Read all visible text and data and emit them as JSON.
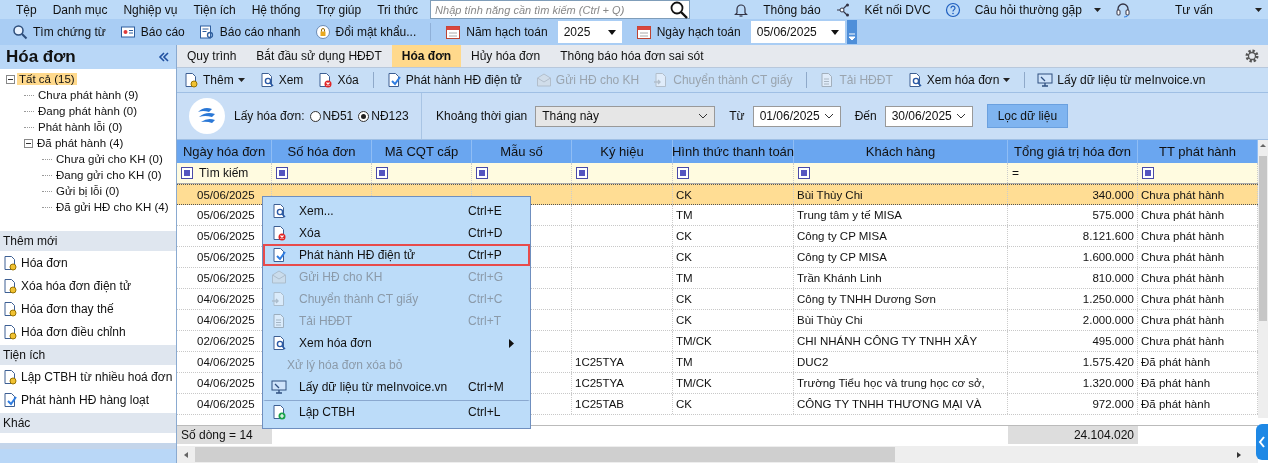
{
  "menu_bar": {
    "items": [
      "Tệp",
      "Danh mục",
      "Nghiệp vụ",
      "Tiện ích",
      "Hệ thống",
      "Trợ giúp",
      "Tri thức"
    ],
    "search": {
      "placeholder": "Nhập tính năng cần tìm kiếm (Ctrl + Q)"
    },
    "links": [
      {
        "label": "Thông báo",
        "dropdown": false
      },
      {
        "label": "Kết nối DVC",
        "dropdown": false
      },
      {
        "label": "Câu hỏi thường gặp",
        "dropdown": true
      },
      {
        "label": "Tư vấn",
        "dropdown": true
      }
    ]
  },
  "toolbar": {
    "buttons": [
      "Tìm chứng từ",
      "Báo cáo",
      "Báo cáo nhanh",
      "Đổi mật khẩu..."
    ],
    "year": {
      "label": "Năm hạch toán",
      "value": "2025"
    },
    "date": {
      "label": "Ngày hạch toán",
      "value": "05/06/2025"
    }
  },
  "sidebar": {
    "title": "Hóa đơn",
    "tree": [
      {
        "label": "Tất cả (15)",
        "selected": true,
        "expanded": true,
        "children": [
          {
            "label": "Chưa phát hành (9)",
            "selected": false
          },
          {
            "label": "Đang phát hành (0)",
            "selected": false
          },
          {
            "label": "Phát hành lỗi (0)",
            "selected": false
          },
          {
            "label": "Đã phát hành (4)",
            "selected": false,
            "expanded": true,
            "children": [
              {
                "label": "Chưa gửi cho KH (0)",
                "selected": false
              },
              {
                "label": "Đang gửi cho KH (0)",
                "selected": false
              },
              {
                "label": "Gửi bị lỗi (0)",
                "selected": false
              },
              {
                "label": "Đã gửi HĐ cho KH (4)",
                "selected": false
              }
            ]
          }
        ]
      }
    ],
    "sections": [
      {
        "title": "Thêm mới",
        "items": [
          "Hóa đơn",
          "Xóa hóa đơn điện tử",
          "Hóa đơn thay thế",
          "Hóa đơn điều chỉnh"
        ]
      },
      {
        "title": "Tiện ích",
        "items": [
          "Lập CTBH từ nhiều hoá đơn",
          "Phát hành HĐ hàng loạt"
        ]
      },
      {
        "title": "Khác"
      }
    ]
  },
  "tabs": [
    {
      "label": "Quy trình",
      "selected": false
    },
    {
      "label": "Bắt đầu sử dụng HĐĐT",
      "selected": false
    },
    {
      "label": "Hóa đơn",
      "selected": true
    },
    {
      "label": "Hủy hóa đơn",
      "selected": false
    },
    {
      "label": "Thông báo hóa đơn sai sót",
      "selected": false
    }
  ],
  "actions": [
    {
      "label": "Thêm",
      "disabled": false,
      "dropdown": true,
      "separator_before": false
    },
    {
      "label": "Xem",
      "disabled": false,
      "dropdown": false,
      "separator_before": false
    },
    {
      "label": "Xóa",
      "disabled": false,
      "dropdown": false,
      "separator_before": false
    },
    {
      "label": "Phát hành HĐ điện tử",
      "disabled": false,
      "dropdown": false,
      "separator_before": true
    },
    {
      "label": "Gửi HĐ cho KH",
      "disabled": true,
      "dropdown": false,
      "separator_before": false
    },
    {
      "label": "Chuyển thành CT giấy",
      "disabled": true,
      "dropdown": false,
      "separator_before": false
    },
    {
      "label": "Tải HĐĐT",
      "disabled": true,
      "dropdown": false,
      "separator_before": true
    },
    {
      "label": "Xem hóa đơn",
      "disabled": false,
      "dropdown": true,
      "separator_before": false
    },
    {
      "label": "Lấy dữ liệu từ meInvoice.vn",
      "disabled": false,
      "dropdown": false,
      "separator_before": true
    }
  ],
  "filter": {
    "source_label": "Lấy hóa đơn:",
    "sources": [
      {
        "label": "NĐ51",
        "selected": false
      },
      {
        "label": "NĐ123",
        "selected": true
      }
    ],
    "period_label": "Khoảng thời gian",
    "period": "Tháng này",
    "from_label": "Từ",
    "from": "01/06/2025",
    "to_label": "Đến",
    "to": "30/06/2025",
    "button": "Lọc dữ liệu"
  },
  "table": {
    "columns": [
      {
        "label": "Ngày hóa đơn",
        "kind": "text"
      },
      {
        "label": "Số hóa đơn",
        "kind": "text"
      },
      {
        "label": "Mã CQT cấp",
        "kind": "text"
      },
      {
        "label": "Mẫu số",
        "kind": "text"
      },
      {
        "label": "Ký hiệu",
        "kind": "text"
      },
      {
        "label": "Hình thức thanh toán",
        "kind": "text"
      },
      {
        "label": "Khách hàng",
        "kind": "text"
      },
      {
        "label": "Tổng giá trị hóa đơn",
        "kind": "amount",
        "filter_op": "="
      },
      {
        "label": "TT phát hành",
        "kind": "text"
      }
    ],
    "search_placeholder": "Tìm kiếm",
    "rows": [
      {
        "date": "05/06/2025",
        "payment": "CK",
        "customer": "Bùi Thùy Chi",
        "total": "340.000",
        "status": "Chưa phát hành",
        "selected": true
      },
      {
        "date": "05/06/2025",
        "payment": "TM",
        "customer": "Trung tâm y tế MISA",
        "total": "575.000",
        "status": "Chưa phát hành",
        "selected": false
      },
      {
        "date": "05/06/2025",
        "payment": "CK",
        "customer": "Công ty CP MISA",
        "total": "8.121.600",
        "status": "Chưa phát hành",
        "selected": false
      },
      {
        "date": "05/06/2025",
        "payment": "CK",
        "customer": "Công ty CP MISA",
        "total": "1.600.000",
        "status": "Chưa phát hành",
        "selected": false
      },
      {
        "date": "05/06/2025",
        "payment": "TM",
        "customer": "Trần Khánh Linh",
        "total": "810.000",
        "status": "Chưa phát hành",
        "selected": false
      },
      {
        "date": "04/06/2025",
        "payment": "CK",
        "customer": "Công ty TNHH Dương Sơn",
        "total": "1.250.000",
        "status": "Chưa phát hành",
        "selected": false
      },
      {
        "date": "04/06/2025",
        "payment": "CK",
        "customer": "Bùi Thùy Chi",
        "total": "2.000.000",
        "status": "Chưa phát hành",
        "selected": false
      },
      {
        "date": "02/06/2025",
        "payment": "TM/CK",
        "customer": "CHI NHÁNH CÔNG TY TNHH XÂY",
        "total": "495.000",
        "status": "Chưa phát hành",
        "selected": false
      },
      {
        "date": "04/06/2025",
        "symbol": "1C25TYA",
        "payment": "TM",
        "customer": "DUC2",
        "total": "1.575.420",
        "status": "Đã phát hành",
        "selected": false
      },
      {
        "date": "04/06/2025",
        "symbol": "1C25TYA",
        "payment": "TM/CK",
        "customer": "Trường Tiểu học và trung học cơ sở,",
        "total": "1.320.000",
        "status": "Đã phát hành",
        "selected": false
      },
      {
        "date": "04/06/2025",
        "symbol": "1C25TAB",
        "payment": "CK",
        "customer": "CÔNG TY TNHH THƯƠNG MẠI VÀ",
        "total": "972.000",
        "status": "Đã phát hành",
        "selected": false
      }
    ],
    "row_count": "Số dòng = 14",
    "total": "24.104.020"
  },
  "context_menu": {
    "items": [
      {
        "label": "Xem...",
        "shortcut": "Ctrl+E",
        "disabled": false,
        "highlighted": false,
        "submenu": false,
        "separator_before": false
      },
      {
        "label": "Xóa",
        "shortcut": "Ctrl+D",
        "disabled": false,
        "highlighted": false,
        "submenu": false,
        "separator_before": false
      },
      {
        "label": "Phát hành HĐ điện tử",
        "shortcut": "Ctrl+P",
        "disabled": false,
        "highlighted": true,
        "submenu": false,
        "separator_before": false
      },
      {
        "label": "Gửi HĐ cho KH",
        "shortcut": "Ctrl+G",
        "disabled": true,
        "highlighted": false,
        "submenu": false,
        "separator_before": false
      },
      {
        "label": "Chuyển thành CT giấy",
        "shortcut": "Ctrl+C",
        "disabled": true,
        "highlighted": false,
        "submenu": false,
        "separator_before": false
      },
      {
        "label": "Tải HĐĐT",
        "shortcut": "Ctrl+T",
        "disabled": true,
        "highlighted": false,
        "submenu": false,
        "separator_before": false
      },
      {
        "label": "Xem hóa đơn",
        "disabled": false,
        "highlighted": false,
        "submenu": true,
        "separator_before": false
      },
      {
        "label": "Xử lý hóa đơn xóa bỏ",
        "disabled": true,
        "highlighted": false,
        "submenu": false,
        "separator_before": false
      },
      {
        "label": "Lấy dữ liệu từ meInvoice.vn",
        "shortcut": "Ctrl+M",
        "disabled": false,
        "highlighted": false,
        "submenu": false,
        "separator_before": false
      },
      {
        "label": "Lập CTBH",
        "shortcut": "Ctrl+L",
        "disabled": false,
        "highlighted": false,
        "submenu": false,
        "separator_before": true
      }
    ]
  }
}
